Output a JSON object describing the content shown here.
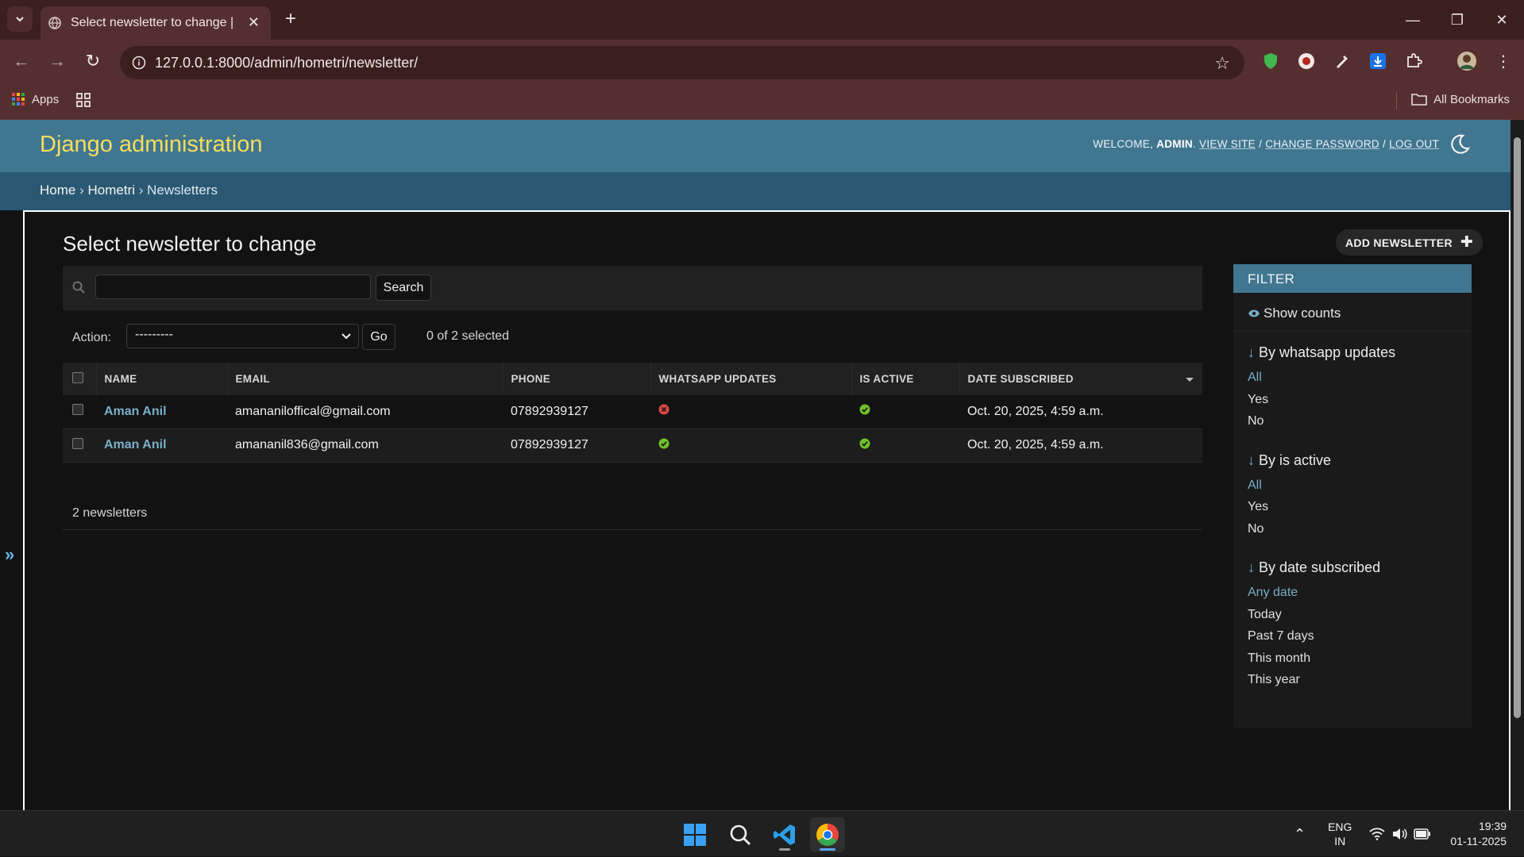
{
  "browser": {
    "tab_title": "Select newsletter to change | Dj",
    "url": "127.0.0.1:8000/admin/hometri/newsletter/",
    "bookmarks_apps": "Apps",
    "bookmarks_all": "All Bookmarks"
  },
  "admin": {
    "brand": "Django administration",
    "welcome": "WELCOME,",
    "username": "ADMIN",
    "view_site": "VIEW SITE",
    "change_password": "CHANGE PASSWORD",
    "log_out": "LOG OUT",
    "sep": "/"
  },
  "breadcrumbs": {
    "home": "Home",
    "app": "Hometri",
    "model": "Newsletters",
    "sep": "›"
  },
  "page": {
    "title": "Select newsletter to change",
    "add_button": "ADD NEWSLETTER",
    "search_button": "Search",
    "action_label": "Action:",
    "action_selected": "---------",
    "go_button": "Go",
    "selected_count": "0 of 2 selected",
    "paginator": "2 newsletters"
  },
  "table": {
    "headers": [
      "NAME",
      "EMAIL",
      "PHONE",
      "WHATSAPP UPDATES",
      "IS ACTIVE",
      "DATE SUBSCRIBED"
    ],
    "rows": [
      {
        "name": "Aman Anil",
        "email": "amananiloffical@gmail.com",
        "phone": "07892939127",
        "whatsapp_updates": false,
        "is_active": true,
        "date": "Oct. 20, 2025, 4:59 a.m."
      },
      {
        "name": "Aman Anil",
        "email": "amananil836@gmail.com",
        "phone": "07892939127",
        "whatsapp_updates": true,
        "is_active": true,
        "date": "Oct. 20, 2025, 4:59 a.m."
      }
    ]
  },
  "filter": {
    "title": "FILTER",
    "show_counts": "Show counts",
    "arrow": "↓",
    "groups": [
      {
        "title": "By whatsapp updates",
        "items": [
          "All",
          "Yes",
          "No"
        ]
      },
      {
        "title": "By is active",
        "items": [
          "All",
          "Yes",
          "No"
        ]
      },
      {
        "title": "By date subscribed",
        "items": [
          "Any date",
          "Today",
          "Past 7 days",
          "This month",
          "This year"
        ]
      }
    ]
  },
  "taskbar": {
    "lang_1": "ENG",
    "lang_2": "IN",
    "time": "19:39",
    "date": "01-11-2025"
  },
  "colors": {
    "header": "#417690",
    "breadcrumbs": "#2a5873",
    "brand": "#f5dd5d",
    "link": "#79aec8",
    "yes": "#70bf2b",
    "no": "#dd4646",
    "chrome_frame": "#3b1f1f",
    "chrome_toolbar": "#552f2f"
  }
}
